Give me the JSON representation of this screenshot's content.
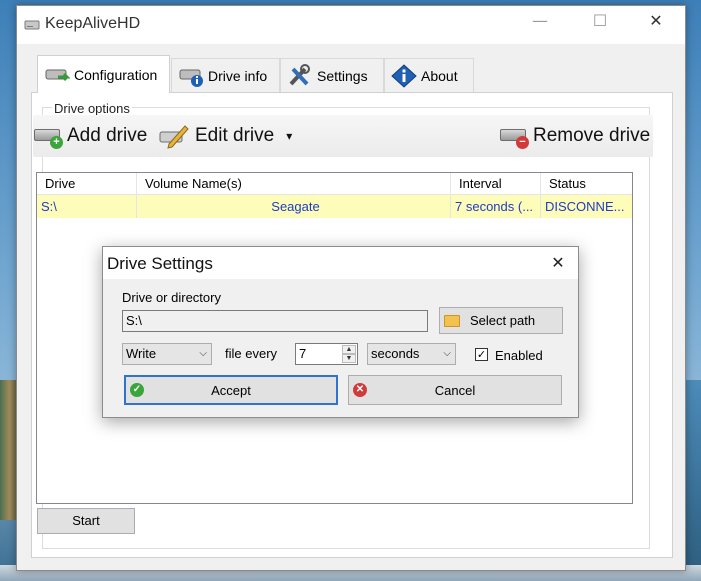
{
  "window": {
    "title": "KeepAliveHD",
    "minimize": "—",
    "maximize": "☐",
    "close": "✕"
  },
  "tabs": [
    {
      "label": "Configuration",
      "icon": "drive-add-icon",
      "active": true
    },
    {
      "label": "Drive info",
      "icon": "drive-info-icon",
      "active": false
    },
    {
      "label": "Settings",
      "icon": "tools-icon",
      "active": false
    },
    {
      "label": "About",
      "icon": "info-icon",
      "active": false
    }
  ],
  "drive_options": {
    "label": "Drive options",
    "add_drive": "Add drive",
    "edit_drive": "Edit drive",
    "edit_dropdown": "▾",
    "remove_drive": "Remove drive"
  },
  "table": {
    "columns": [
      "Drive",
      "Volume Name(s)",
      "Interval",
      "Status"
    ],
    "rows": [
      {
        "drive": "S:\\",
        "volume": "Seagate",
        "interval": "7 seconds (...",
        "status": "DISCONNE..."
      }
    ]
  },
  "start_button": "Start",
  "dialog": {
    "title": "Drive Settings",
    "close": "✕",
    "drive_label": "Drive or directory",
    "drive_value": "S:\\",
    "select_path": "Select path",
    "mode_value": "Write",
    "file_every": "file every",
    "interval_value": "7",
    "unit_value": "seconds",
    "enabled_label": "Enabled",
    "enabled_check": "✓",
    "accept": "Accept",
    "cancel": "Cancel"
  },
  "colors": {
    "accent": "#2f73cf",
    "row_highlight": "#fdfcb8",
    "row_text": "#1f3cc6"
  }
}
